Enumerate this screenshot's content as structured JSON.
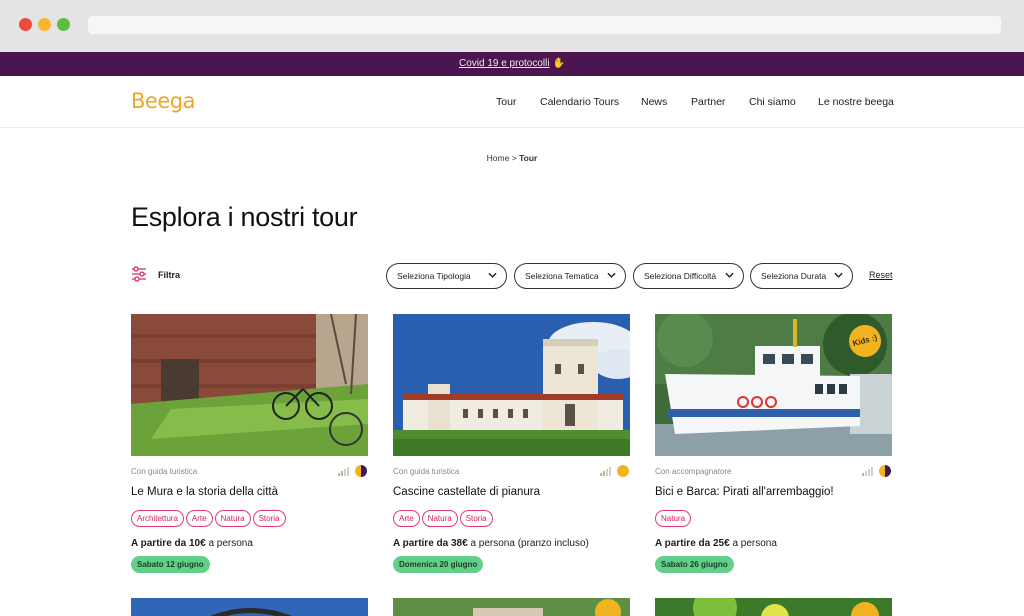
{
  "banner": {
    "link_text": "Covid 19 e protocolli",
    "emoji": "✋"
  },
  "brand": {
    "logo_text": "Beeg",
    "logo_tail": "a",
    "accent": "#eda626",
    "banner_bg": "#4b1650",
    "tag_color": "#e23a73",
    "date_bg": "#62d08a"
  },
  "nav": [
    "Tour",
    "Calendario Tours",
    "News",
    "Partner",
    "Chi siamo",
    "Le nostre beega"
  ],
  "breadcrumb": {
    "home": "Home",
    "sep": ">",
    "current": "Tour"
  },
  "page_title": "Esplora i nostri tour",
  "filters": {
    "label": "Filtra",
    "selects": [
      "Seleziona Tipologia",
      "Seleziona Tematica",
      "Seleziona Difficoltà",
      "Seleziona Durata"
    ],
    "reset": "Reset"
  },
  "cards": [
    {
      "guide": "Con guida turistica",
      "title": "Le Mura e la storia della città",
      "tags": [
        "Architettura",
        "Arte",
        "Natura",
        "Storia"
      ],
      "price_prefix": "A partire da",
      "price": "10€",
      "price_suffix": "a persona",
      "date": "Sabato 12 giugno",
      "difficulty_level": 2,
      "duration_icon": "half-day-icon"
    },
    {
      "guide": "Con guida turistica",
      "title": "Cascine castellate di pianura",
      "tags": [
        "Arte",
        "Natura",
        "Storia"
      ],
      "price_prefix": "A partire da",
      "price": "38€",
      "price_suffix": "a persona (pranzo incluso)",
      "date": "Domenica 20 giugno",
      "difficulty_level": 2,
      "duration_icon": "full-day-icon"
    },
    {
      "guide": "Con accompagnatore",
      "title": "Bici e Barca: Pirati all'arrembaggio!",
      "tags": [
        "Natura"
      ],
      "price_prefix": "A partire da",
      "price": "25€",
      "price_suffix": "a persona",
      "date": "Sabato 26 giugno",
      "badge": "Kids :)",
      "difficulty_level": 1,
      "duration_icon": "half-day-icon"
    }
  ]
}
